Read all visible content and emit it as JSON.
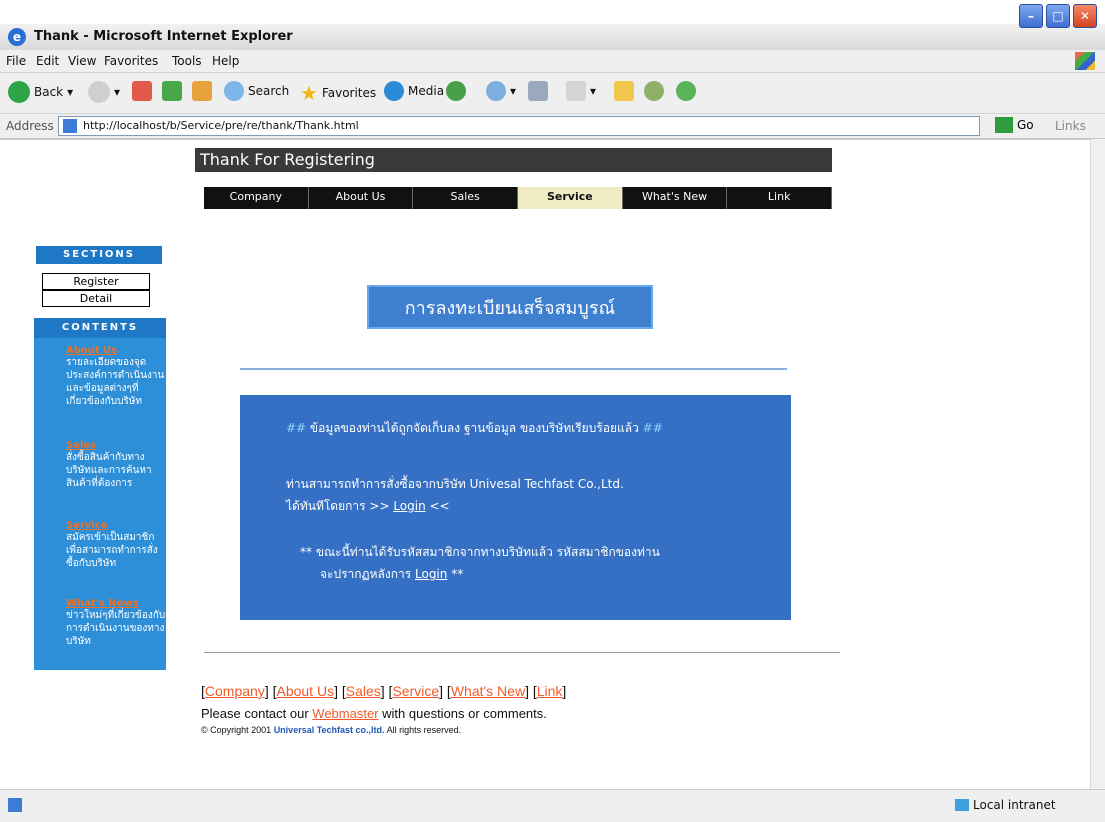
{
  "window": {
    "title": "Thank - Microsoft Internet Explorer",
    "min": "–",
    "max": "□",
    "close": "✕"
  },
  "menu": [
    "File",
    "Edit",
    "View",
    "Favorites",
    "Tools",
    "Help"
  ],
  "toolbar": {
    "back": "Back",
    "search": "Search",
    "favorites": "Favorites",
    "media": "Media"
  },
  "address": {
    "label": "Address",
    "url": "http://localhost/b/Service/pre/re/thank/Thank.html",
    "go": "Go",
    "links": "Links"
  },
  "page": {
    "title": "Thank For Registering",
    "nav": [
      "Company",
      "About Us",
      "Sales",
      "Service",
      "What's New",
      "Link"
    ],
    "nav_active": "Service",
    "sections_label": "SECTIONS",
    "section_buttons": [
      "Register",
      "Detail"
    ],
    "contents_label": "CONTENTS",
    "sidebar": [
      {
        "heading": "About Us",
        "desc": "รายละเอียดของจุดประสงค์การดำเนินงานและข้อมูลต่างๆที่เกี่ยวข้องกับบริษัท"
      },
      {
        "heading": "Sales",
        "desc": "สั่งซื้อสินค้ากับทางบริษัทและการค้นหาสินค้าที่ต้องการ"
      },
      {
        "heading": "Service",
        "desc": "สมัครเข้าเป็นสมาชิกเพื่อสามารถทำการสั่งซื้อกับบริษัท"
      },
      {
        "heading": "What's News",
        "desc": "ข่าวใหม่ๆที่เกี่ยวข้องกับการดำเนินงานของทางบริษัท"
      }
    ],
    "thai_heading": "การลงทะเบียนเสร็จสมบูรณ์",
    "message": {
      "line1_hash_left": "##",
      "line1": " ข้อมูลของท่านได้ถูกจัดเก็บลง ฐานข้อมูล ของบริษัทเรียบร้อยแล้ว ",
      "line1_hash_right": "##",
      "line2a": "ท่านสามารถทำการสั่งซื้อจากบริษัท Univesal Techfast Co.,Ltd.",
      "line2b_pre": "ได้ทันทีโดยการ >> ",
      "login": "Login",
      "line2b_post": " <<",
      "line3a": "** ขณะนี้ท่านได้รับรหัสสมาชิกจากทางบริษัทแล้ว รหัสสมาชิกของท่าน",
      "line3b_pre": "จะปรากฏหลังการ ",
      "line3b_post": " **"
    },
    "footer_links": [
      "Company",
      "About Us",
      "Sales",
      "Service",
      "What's New",
      "Link"
    ],
    "contact_pre": "Please contact our ",
    "contact_link": "Webmaster",
    "contact_post": " with questions or comments.",
    "copyright_pre": "© Copyright 2001 ",
    "copyright_company": "Universal Techfast co.,ltd.",
    "copyright_post": " All rights reserved."
  },
  "status": {
    "zone": "Local intranet"
  }
}
